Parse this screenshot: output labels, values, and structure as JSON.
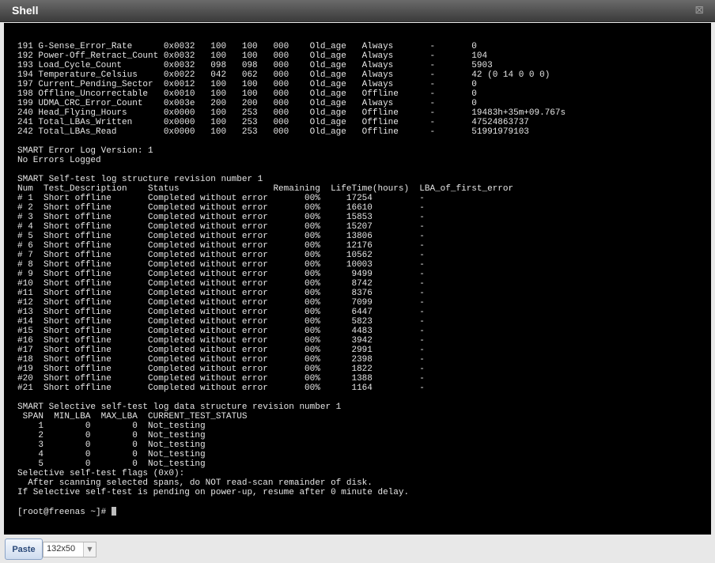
{
  "window": {
    "title": "Shell",
    "close_icon": "⊠"
  },
  "terminal": {
    "lines": [
      "191 G-Sense_Error_Rate      0x0032   100   100   000    Old_age   Always       -       0",
      "192 Power-Off_Retract_Count 0x0032   100   100   000    Old_age   Always       -       104",
      "193 Load_Cycle_Count        0x0032   098   098   000    Old_age   Always       -       5903",
      "194 Temperature_Celsius     0x0022   042   062   000    Old_age   Always       -       42 (0 14 0 0 0)",
      "197 Current_Pending_Sector  0x0012   100   100   000    Old_age   Always       -       0",
      "198 Offline_Uncorrectable   0x0010   100   100   000    Old_age   Offline      -       0",
      "199 UDMA_CRC_Error_Count    0x003e   200   200   000    Old_age   Always       -       0",
      "240 Head_Flying_Hours       0x0000   100   253   000    Old_age   Offline      -       19483h+35m+09.767s",
      "241 Total_LBAs_Written      0x0000   100   253   000    Old_age   Offline      -       47524863737",
      "242 Total_LBAs_Read         0x0000   100   253   000    Old_age   Offline      -       51991979103",
      "",
      "SMART Error Log Version: 1",
      "No Errors Logged",
      "",
      "SMART Self-test log structure revision number 1",
      "Num  Test_Description    Status                  Remaining  LifeTime(hours)  LBA_of_first_error",
      "# 1  Short offline       Completed without error       00%     17254         -",
      "# 2  Short offline       Completed without error       00%     16610         -",
      "# 3  Short offline       Completed without error       00%     15853         -",
      "# 4  Short offline       Completed without error       00%     15207         -",
      "# 5  Short offline       Completed without error       00%     13806         -",
      "# 6  Short offline       Completed without error       00%     12176         -",
      "# 7  Short offline       Completed without error       00%     10562         -",
      "# 8  Short offline       Completed without error       00%     10003         -",
      "# 9  Short offline       Completed without error       00%      9499         -",
      "#10  Short offline       Completed without error       00%      8742         -",
      "#11  Short offline       Completed without error       00%      8376         -",
      "#12  Short offline       Completed without error       00%      7099         -",
      "#13  Short offline       Completed without error       00%      6447         -",
      "#14  Short offline       Completed without error       00%      5823         -",
      "#15  Short offline       Completed without error       00%      4483         -",
      "#16  Short offline       Completed without error       00%      3942         -",
      "#17  Short offline       Completed without error       00%      2991         -",
      "#18  Short offline       Completed without error       00%      2398         -",
      "#19  Short offline       Completed without error       00%      1822         -",
      "#20  Short offline       Completed without error       00%      1388         -",
      "#21  Short offline       Completed without error       00%      1164         -",
      "",
      "SMART Selective self-test log data structure revision number 1",
      " SPAN  MIN_LBA  MAX_LBA  CURRENT_TEST_STATUS",
      "    1        0        0  Not_testing",
      "    2        0        0  Not_testing",
      "    3        0        0  Not_testing",
      "    4        0        0  Not_testing",
      "    5        0        0  Not_testing",
      "Selective self-test flags (0x0):",
      "  After scanning selected spans, do NOT read-scan remainder of disk.",
      "If Selective self-test is pending on power-up, resume after 0 minute delay.",
      ""
    ],
    "prompt": "[root@freenas ~]# "
  },
  "toolbar": {
    "paste_label": "Paste",
    "size_value": "132x50",
    "dropdown_icon": "▼"
  }
}
